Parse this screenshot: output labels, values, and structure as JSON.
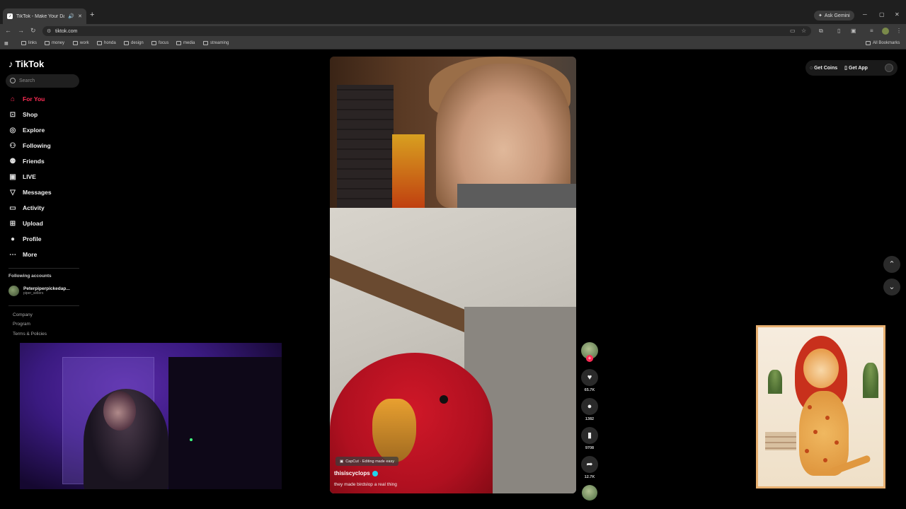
{
  "browser": {
    "tab_title": "TikTok - Make Your Day",
    "tab_favicon": "tiktok-icon",
    "url": "tiktok.com",
    "gemini_label": "Ask Gemini",
    "bookmarks": [
      "links",
      "money",
      "work",
      "honda",
      "design",
      "focus",
      "media",
      "streaming"
    ],
    "all_bookmarks": "All Bookmarks"
  },
  "tiktok": {
    "brand": "TikTok",
    "search_placeholder": "Search",
    "nav": [
      {
        "label": "For You",
        "icon": "home-icon",
        "active": true
      },
      {
        "label": "Shop",
        "icon": "shop-icon"
      },
      {
        "label": "Explore",
        "icon": "compass-icon"
      },
      {
        "label": "Following",
        "icon": "following-icon"
      },
      {
        "label": "Friends",
        "icon": "friends-icon"
      },
      {
        "label": "LIVE",
        "icon": "live-icon"
      },
      {
        "label": "Messages",
        "icon": "messages-icon"
      },
      {
        "label": "Activity",
        "icon": "activity-icon"
      },
      {
        "label": "Upload",
        "icon": "upload-icon"
      },
      {
        "label": "Profile",
        "icon": "profile-icon"
      },
      {
        "label": "More",
        "icon": "more-icon"
      }
    ],
    "following_title": "Following accounts",
    "following": [
      {
        "name": "Peterpiperpickedap...",
        "handle": "piper_sellers"
      }
    ],
    "footer": [
      "Company",
      "Program",
      "Terms & Policies"
    ],
    "get_coins": "Get Coins",
    "get_app": "Get App",
    "video": {
      "capcut": "CapCut · Editing made easy",
      "author": "thisiscyclops",
      "description": "they made birdslop a real thing"
    },
    "actions": {
      "likes": "65.7K",
      "comments": "1382",
      "saves": "9708",
      "shares": "12.7K"
    }
  },
  "colors": {
    "accent": "#fe2c55",
    "chrome": "#3a3a3a",
    "background": "#000000"
  }
}
